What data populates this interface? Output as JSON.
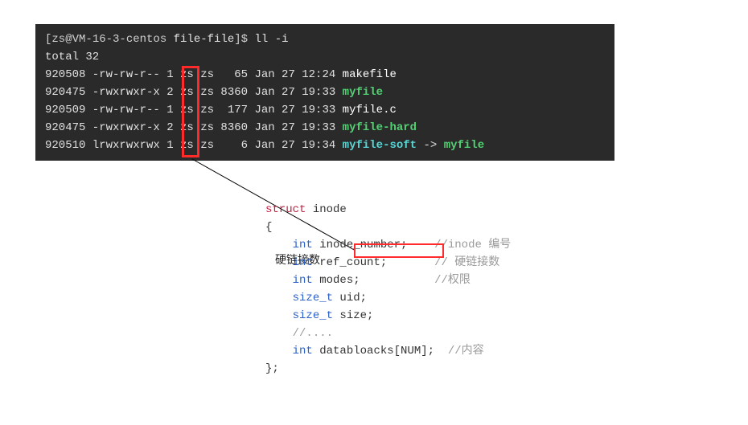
{
  "terminal": {
    "prompt_user": "zs@VM-16-3-centos",
    "prompt_dir": "file-file",
    "command": "ll -i",
    "total_line": "total 32",
    "rows": [
      {
        "inode": "920508",
        "perm": "-rw-rw-r--",
        "links": "1",
        "owner": "zs",
        "group": "zs",
        "size": "65",
        "date": "Jan 27",
        "time": "12:24",
        "name": "makefile",
        "color": "fn-white",
        "arrow": "",
        "target": ""
      },
      {
        "inode": "920475",
        "perm": "-rwxrwxr-x",
        "links": "2",
        "owner": "zs",
        "group": "zs",
        "size": "8360",
        "date": "Jan 27",
        "time": "19:33",
        "name": "myfile",
        "color": "fn-green",
        "arrow": "",
        "target": ""
      },
      {
        "inode": "920509",
        "perm": "-rw-rw-r--",
        "links": "1",
        "owner": "zs",
        "group": "zs",
        "size": "177",
        "date": "Jan 27",
        "time": "19:33",
        "name": "myfile.c",
        "color": "fn-white",
        "arrow": "",
        "target": ""
      },
      {
        "inode": "920475",
        "perm": "-rwxrwxr-x",
        "links": "2",
        "owner": "zs",
        "group": "zs",
        "size": "8360",
        "date": "Jan 27",
        "time": "19:33",
        "name": "myfile-hard",
        "color": "fn-green",
        "arrow": "",
        "target": ""
      },
      {
        "inode": "920510",
        "perm": "lrwxrwxrwx",
        "links": "1",
        "owner": "zs",
        "group": "zs",
        "size": "6",
        "date": "Jan 27",
        "time": "19:34",
        "name": "myfile-soft",
        "color": "fn-cyan",
        "arrow": " -> ",
        "target": "myfile"
      }
    ]
  },
  "label": "硬链接数",
  "code": {
    "l0": "struct",
    "l0b": " inode",
    "l1": "{",
    "l2a": "int",
    "l2b": " inode_number;",
    "l2c": "//inode 编号",
    "l3a": "int",
    "l3b": " ref_count;",
    "l3c": "// 硬链接数",
    "l4a": "int",
    "l4b": " modes;",
    "l4c": "//权限",
    "l5a": "size_t",
    "l5b": " uid;",
    "l6a": "size_t",
    "l6b": " size;",
    "l7": "//....",
    "l8a": "int",
    "l8b": " databloacks[NUM];",
    "l8c": "//内容",
    "l9": "};"
  }
}
